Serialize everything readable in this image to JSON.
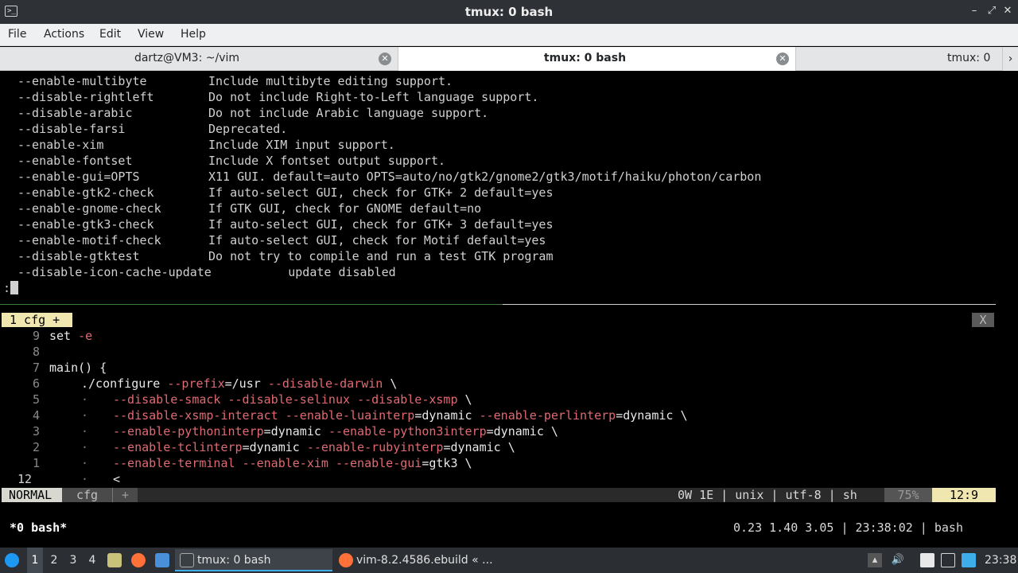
{
  "window": {
    "title": "tmux: 0 bash",
    "buttons": {
      "minimize": "–",
      "maximize": "⤢",
      "close": "✕"
    }
  },
  "menu": [
    "File",
    "Actions",
    "Edit",
    "View",
    "Help"
  ],
  "tabs": [
    {
      "label": "dartz@VM3: ~/vim",
      "active": false
    },
    {
      "label": "tmux: 0 bash",
      "active": true
    },
    {
      "label": "tmux: 0",
      "active": false
    }
  ],
  "configure_help": [
    {
      "option": "--enable-multibyte",
      "description": "Include multibyte editing support."
    },
    {
      "option": "--disable-rightleft",
      "description": "Do not include Right-to-Left language support."
    },
    {
      "option": "--disable-arabic",
      "description": "Do not include Arabic language support."
    },
    {
      "option": "--disable-farsi",
      "description": "Deprecated."
    },
    {
      "option": "--enable-xim",
      "description": "Include XIM input support."
    },
    {
      "option": "--enable-fontset",
      "description": "Include X fontset output support."
    },
    {
      "option": "--enable-gui=OPTS",
      "description": "X11 GUI. default=auto OPTS=auto/no/gtk2/gnome2/gtk3/motif/haiku/photon/carbon"
    },
    {
      "option": "--enable-gtk2-check",
      "description": "If auto-select GUI, check for GTK+ 2 default=yes"
    },
    {
      "option": "--enable-gnome-check",
      "description": "If GTK GUI, check for GNOME default=no"
    },
    {
      "option": "--enable-gtk3-check",
      "description": "If auto-select GUI, check for GTK+ 3 default=yes"
    },
    {
      "option": "--enable-motif-check",
      "description": "If auto-select GUI, check for Motif default=yes"
    },
    {
      "option": "--disable-gtktest",
      "description": "Do not try to compile and run a test GTK program"
    },
    {
      "option": "--disable-icon-cache-update",
      "description": "        update disabled"
    }
  ],
  "prompt": ":",
  "vim": {
    "tab_label": "1 cfg +",
    "close_label": "X",
    "lines": [
      {
        "num": "9",
        "text": "set -e"
      },
      {
        "num": "8",
        "text": ""
      },
      {
        "num": "7",
        "text": "main() {"
      },
      {
        "num": "6",
        "text": "./configure --prefix=/usr --disable-darwin \\"
      },
      {
        "num": "5",
        "text": "--disable-smack --disable-selinux --disable-xsmp \\"
      },
      {
        "num": "4",
        "text": "--disable-xsmp-interact --enable-luainterp=dynamic --enable-perlinterp=dynamic \\"
      },
      {
        "num": "3",
        "text": "--enable-pythoninterp=dynamic --enable-python3interp=dynamic \\"
      },
      {
        "num": "2",
        "text": "--enable-tclinterp=dynamic --enable-rubyinterp=dynamic \\"
      },
      {
        "num": "1",
        "text": "--enable-terminal --enable-xim --enable-gui=gtk3 \\"
      },
      {
        "num": "12",
        "text": "<"
      }
    ],
    "dot": "·",
    "status": {
      "mode": "NORMAL",
      "file": "cfg",
      "modified": "+",
      "info": "0W 1E | unix | utf-8 | sh",
      "percent": "75%",
      "position": "12:9"
    }
  },
  "tmux": {
    "left": "*0 bash*",
    "right": "0.23 1.40 3.05 | 23:38:02 | bash"
  },
  "taskbar": {
    "desktops": [
      "1",
      "2",
      "3",
      "4"
    ],
    "active_desktop": "1",
    "tasks": [
      {
        "label": "tmux: 0 bash",
        "icon": "terminal-icon",
        "active": true
      },
      {
        "label": "vim-8.2.4586.ebuild « ...",
        "icon": "firefox-icon",
        "active": false
      }
    ],
    "clock": "23:38"
  },
  "colors": {
    "terminal_bg": "#000000",
    "vim_flag": "#e06a72",
    "vim_tab": "#f0e6b0",
    "accent": "#3daee9"
  }
}
